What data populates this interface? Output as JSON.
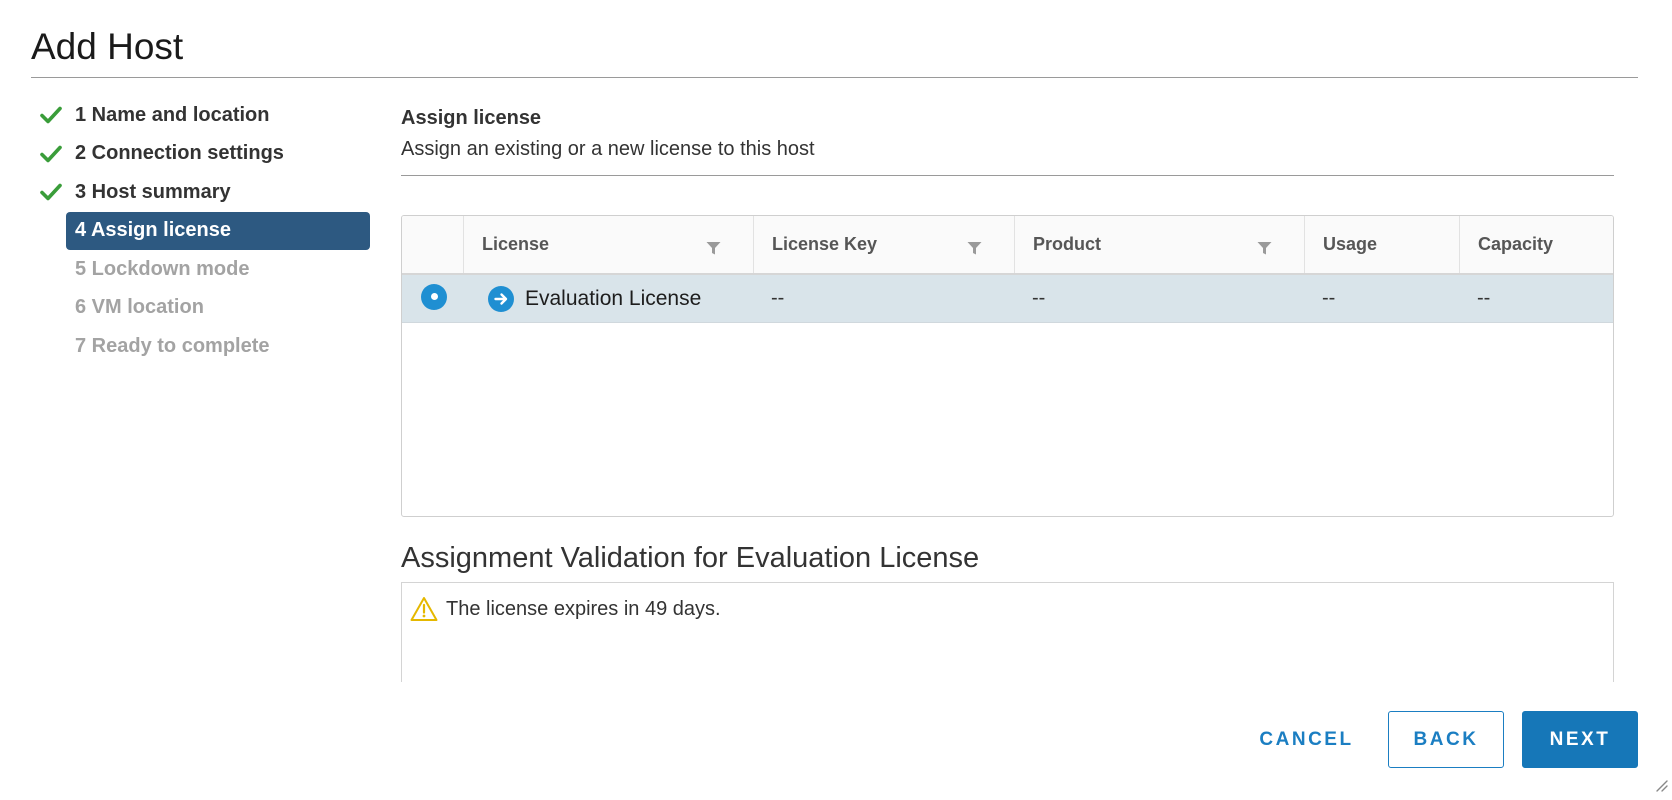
{
  "dialog": {
    "title": "Add Host"
  },
  "steps": [
    {
      "label": "1 Name and location",
      "state": "done"
    },
    {
      "label": "2 Connection settings",
      "state": "done"
    },
    {
      "label": "3 Host summary",
      "state": "done"
    },
    {
      "label": "4 Assign license",
      "state": "current"
    },
    {
      "label": "5 Lockdown mode",
      "state": "pending"
    },
    {
      "label": "6 VM location",
      "state": "pending"
    },
    {
      "label": "7 Ready to complete",
      "state": "pending"
    }
  ],
  "main": {
    "heading": "Assign license",
    "subheading": "Assign an existing or a new license to this host"
  },
  "grid": {
    "columns": [
      "License",
      "License Key",
      "Product",
      "Usage",
      "Capacity"
    ],
    "filterable": [
      true,
      true,
      true,
      false,
      false
    ],
    "rows": [
      {
        "selected": true,
        "icon": "arrow-right-circle-icon",
        "license": "Evaluation License",
        "license_key": "--",
        "product": "--",
        "usage": "--",
        "capacity": "--"
      }
    ]
  },
  "validation": {
    "title": "Assignment Validation for Evaluation License",
    "message": "The license expires in 49 days.",
    "icon": "warning-icon"
  },
  "footer": {
    "cancel_label": "CANCEL",
    "back_label": "BACK",
    "next_label": "NEXT"
  },
  "colors": {
    "accent": "#1b7ec2",
    "primary_button": "#1677b8",
    "current_step_bg": "#2d5981",
    "check_green": "#3a9d3a",
    "selected_row_bg": "#d9e4ea",
    "warning": "#e5b800"
  }
}
